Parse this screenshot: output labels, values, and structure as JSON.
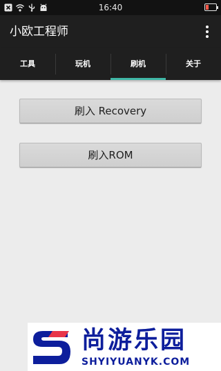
{
  "status_bar": {
    "time": "16:40",
    "icons": [
      "notification-x-icon",
      "wifi-icon",
      "usb-icon",
      "android-icon"
    ],
    "battery_color": "#ff5a4a",
    "battery_level": 0.25
  },
  "app_bar": {
    "title": "小欧工程师",
    "menu_icon": "overflow-menu-icon"
  },
  "tabs": [
    {
      "label": "工具",
      "active": false
    },
    {
      "label": "玩机",
      "active": false
    },
    {
      "label": "刷机",
      "active": true
    },
    {
      "label": "关于",
      "active": false
    }
  ],
  "accent_color": "#3fb7a6",
  "buttons": {
    "flash_recovery": "刷入 Recovery",
    "flash_rom": "刷入ROM"
  },
  "watermark": {
    "name": "尚游乐园",
    "url": "SHYIYUANYK.COM",
    "color": "#0d1e9c"
  }
}
